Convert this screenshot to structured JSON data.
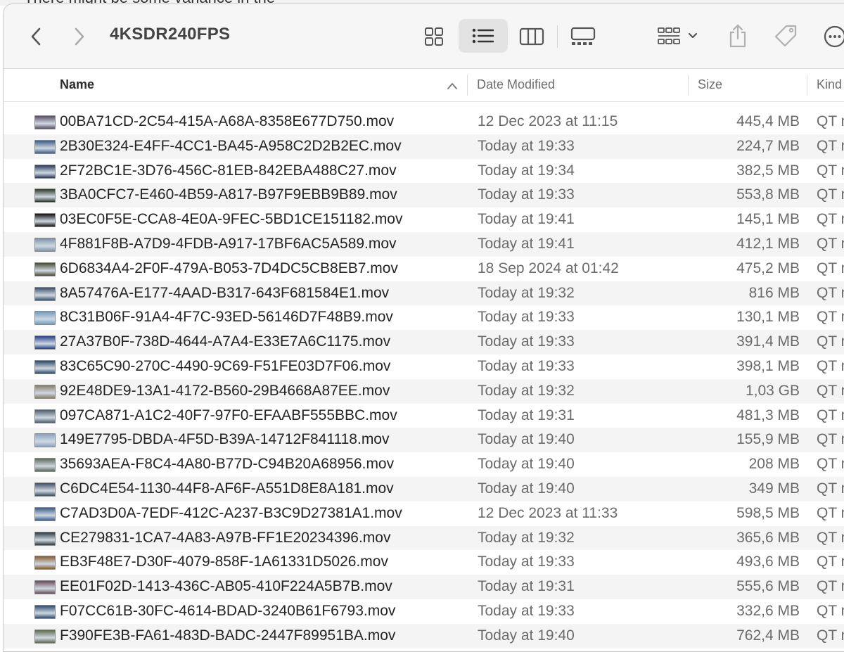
{
  "background_text": "There might be some variance in the",
  "window": {
    "title": "4KSDR240FPS",
    "icons": {
      "back": "chevron-left-icon",
      "forward": "chevron-right-icon",
      "grid_view": "grid-view-icon",
      "list_view": "list-view-icon",
      "column_view": "column-view-icon",
      "gallery_view": "gallery-view-icon",
      "group": "group-icon",
      "share": "share-icon",
      "tag": "tag-icon",
      "more": "more-icon"
    }
  },
  "columns": {
    "name": "Name",
    "date": "Date Modified",
    "size": "Size",
    "kind": "Kind"
  },
  "files": [
    {
      "name": "00BA71CD-2C54-415A-A68A-8358E677D750.mov",
      "date": "12 Dec 2023 at 11:15",
      "size": "445,4 MB",
      "kind": "QT movie",
      "thumb": "#5a4f66"
    },
    {
      "name": "2B30E324-E4FF-4CC1-BA45-A958C2D2B2EC.mov",
      "date": "Today at 19:33",
      "size": "224,7 MB",
      "kind": "QT movie",
      "thumb": "#3d5c86"
    },
    {
      "name": "2F72BC1E-3D76-456C-81EB-842EBA488C27.mov",
      "date": "Today at 19:34",
      "size": "382,5 MB",
      "kind": "QT movie",
      "thumb": "#2a3a5c"
    },
    {
      "name": "3BA0CFC7-E460-4B59-A817-B97F9EBB9B89.mov",
      "date": "Today at 19:33",
      "size": "553,8 MB",
      "kind": "QT movie",
      "thumb": "#2c3a28"
    },
    {
      "name": "03EC0F5E-CCA8-4E0A-9FEC-5BD1CE151182.mov",
      "date": "Today at 19:41",
      "size": "145,1 MB",
      "kind": "QT movie",
      "thumb": "#111111"
    },
    {
      "name": "4F881F8B-A7D9-4FDB-A917-17BF6AC5A589.mov",
      "date": "Today at 19:41",
      "size": "412,1 MB",
      "kind": "QT movie",
      "thumb": "#7d94a8"
    },
    {
      "name": "6D6834A4-2F0F-479A-B053-7D4DC5CB8EB7.mov",
      "date": "18 Sep 2024 at 01:42",
      "size": "475,2 MB",
      "kind": "QT movie",
      "thumb": "#4a4a32"
    },
    {
      "name": "8A57476A-E177-4AAD-B317-643F681584E1.mov",
      "date": "Today at 19:32",
      "size": "816 MB",
      "kind": "QT movie",
      "thumb": "#38506c"
    },
    {
      "name": "8C31B06F-91A4-4F7C-93ED-56146D7F48B9.mov",
      "date": "Today at 19:33",
      "size": "130,1 MB",
      "kind": "QT movie",
      "thumb": "#6f9bc0"
    },
    {
      "name": "27A37B0F-738D-4644-A7A4-E33E7A6C1175.mov",
      "date": "Today at 19:33",
      "size": "391,4 MB",
      "kind": "QT movie",
      "thumb": "#24428a"
    },
    {
      "name": "83C65C90-270C-4490-9C69-F51FE03D7F06.mov",
      "date": "Today at 19:33",
      "size": "398,1 MB",
      "kind": "QT movie",
      "thumb": "#2c4766"
    },
    {
      "name": "92E48DE9-13A1-4172-B560-29B4668A87EE.mov",
      "date": "Today at 19:32",
      "size": "1,03 GB",
      "kind": "QT movie",
      "thumb": "#8a7d6a"
    },
    {
      "name": "097CA871-A1C2-40F7-97F0-EFAABF555BBC.mov",
      "date": "Today at 19:31",
      "size": "481,3 MB",
      "kind": "QT movie",
      "thumb": "#4b5e70"
    },
    {
      "name": "149E7795-DBDA-4F5D-B39A-14712F841118.mov",
      "date": "Today at 19:40",
      "size": "155,9 MB",
      "kind": "QT movie",
      "thumb": "#8aa2c2"
    },
    {
      "name": "35693AEA-F8C4-4A80-B77D-C94B20A68956.mov",
      "date": "Today at 19:40",
      "size": "208 MB",
      "kind": "QT movie",
      "thumb": "#5b6a5a"
    },
    {
      "name": "C6DC4E54-1130-44F8-AF6F-A551D8E8A181.mov",
      "date": "Today at 19:40",
      "size": "349 MB",
      "kind": "QT movie",
      "thumb": "#3e4f66"
    },
    {
      "name": "C7AD3D0A-7EDF-412C-A237-B3C9D27381A1.mov",
      "date": "12 Dec 2023 at 11:33",
      "size": "598,5 MB",
      "kind": "QT movie",
      "thumb": "#3a5a8c"
    },
    {
      "name": "CE279831-1CA7-4A83-A97B-FF1E20234396.mov",
      "date": "Today at 19:32",
      "size": "365,6 MB",
      "kind": "QT movie",
      "thumb": "#2f3a44"
    },
    {
      "name": "EB3F48E7-D30F-4079-858F-1A61331D5026.mov",
      "date": "Today at 19:33",
      "size": "493,6 MB",
      "kind": "QT movie",
      "thumb": "#8a5a2a"
    },
    {
      "name": "EE01F02D-1413-436C-AB05-410F224A5B7B.mov",
      "date": "Today at 19:31",
      "size": "555,6 MB",
      "kind": "QT movie",
      "thumb": "#6a4a5a"
    },
    {
      "name": "F07CC61B-30FC-4614-BDAD-3240B61F6793.mov",
      "date": "Today at 19:33",
      "size": "332,6 MB",
      "kind": "QT movie",
      "thumb": "#2d4a70"
    },
    {
      "name": "F390FE3B-FA61-483D-BADC-2447F89951BA.mov",
      "date": "Today at 19:40",
      "size": "762,4 MB",
      "kind": "QT movie",
      "thumb": "#5e6b4e"
    }
  ]
}
